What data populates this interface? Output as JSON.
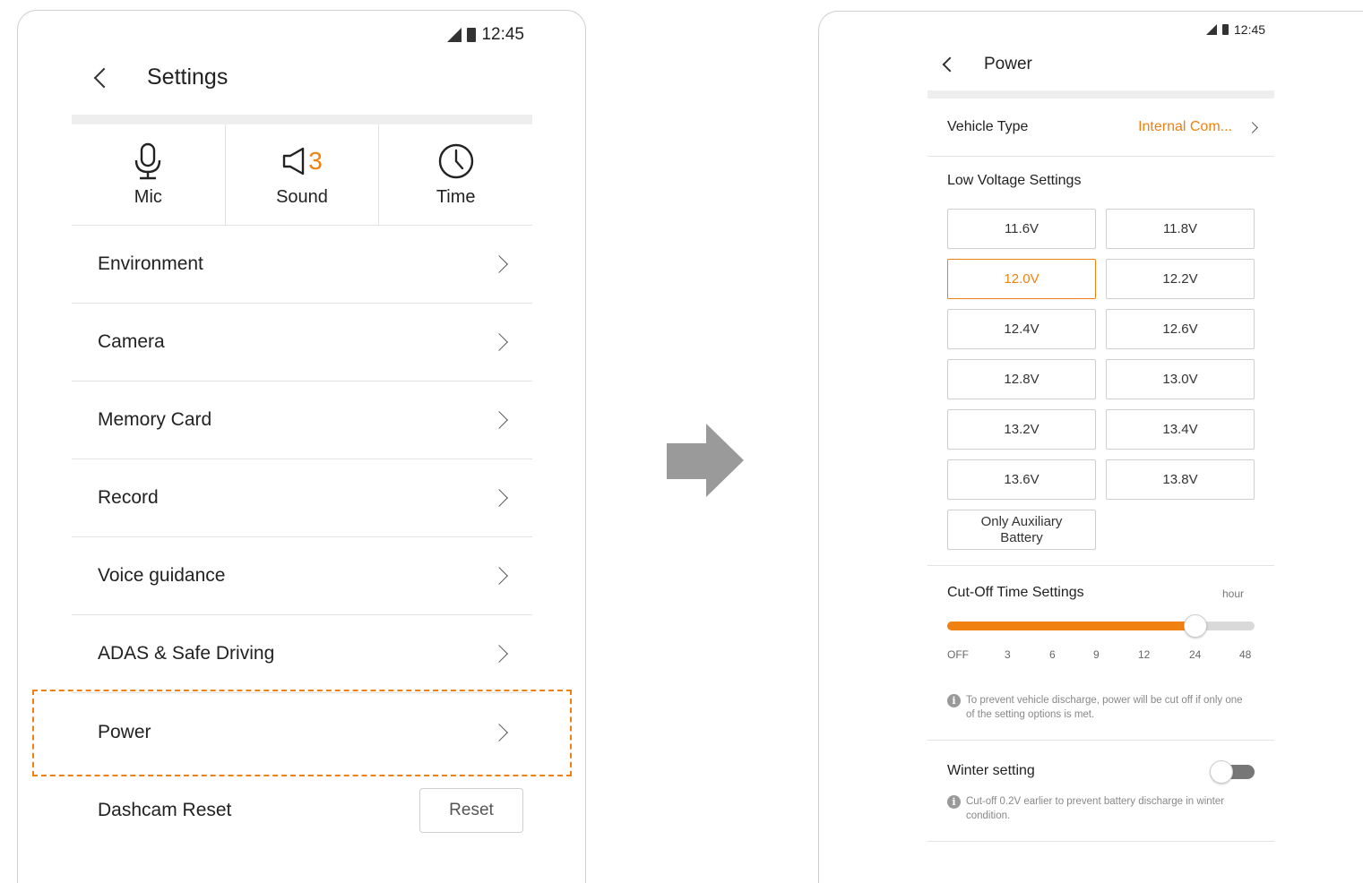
{
  "status": {
    "time": "12:45"
  },
  "settings": {
    "title": "Settings",
    "quick": [
      {
        "label": "Mic",
        "icon": "mic-icon"
      },
      {
        "label": "Sound",
        "icon": "speaker-icon",
        "count": "3"
      },
      {
        "label": "Time",
        "icon": "clock-icon"
      }
    ],
    "menu": [
      {
        "label": "Environment"
      },
      {
        "label": "Camera"
      },
      {
        "label": "Memory Card"
      },
      {
        "label": "Record"
      },
      {
        "label": "Voice guidance"
      },
      {
        "label": "ADAS & Safe Driving"
      },
      {
        "label": "Power"
      }
    ],
    "reset_row": {
      "label": "Dashcam Reset",
      "button": "Reset"
    }
  },
  "power": {
    "title": "Power",
    "vehicle_type": {
      "label": "Vehicle Type",
      "value": "Internal Com..."
    },
    "low_voltage": {
      "title": "Low Voltage Settings",
      "options": [
        "11.6V",
        "11.8V",
        "12.0V",
        "12.2V",
        "12.4V",
        "12.6V",
        "12.8V",
        "13.0V",
        "13.2V",
        "13.4V",
        "13.6V",
        "13.8V",
        "Only Auxiliary Battery"
      ],
      "selected": "12.0V"
    },
    "cutoff": {
      "title": "Cut-Off Time Settings",
      "unit": "hour",
      "ticks": [
        "OFF",
        "3",
        "6",
        "9",
        "12",
        "24",
        "48"
      ],
      "selected": "24",
      "note": "To prevent vehicle discharge, power will be cut off if only one of the setting options is met."
    },
    "winter": {
      "title": "Winter setting",
      "enabled": false,
      "note": "Cut-off 0.2V earlier to prevent battery discharge in winter condition."
    }
  },
  "colors": {
    "accent": "#f0800f",
    "divider": "#e2e2e2",
    "arrow": "#9a9a9a"
  }
}
